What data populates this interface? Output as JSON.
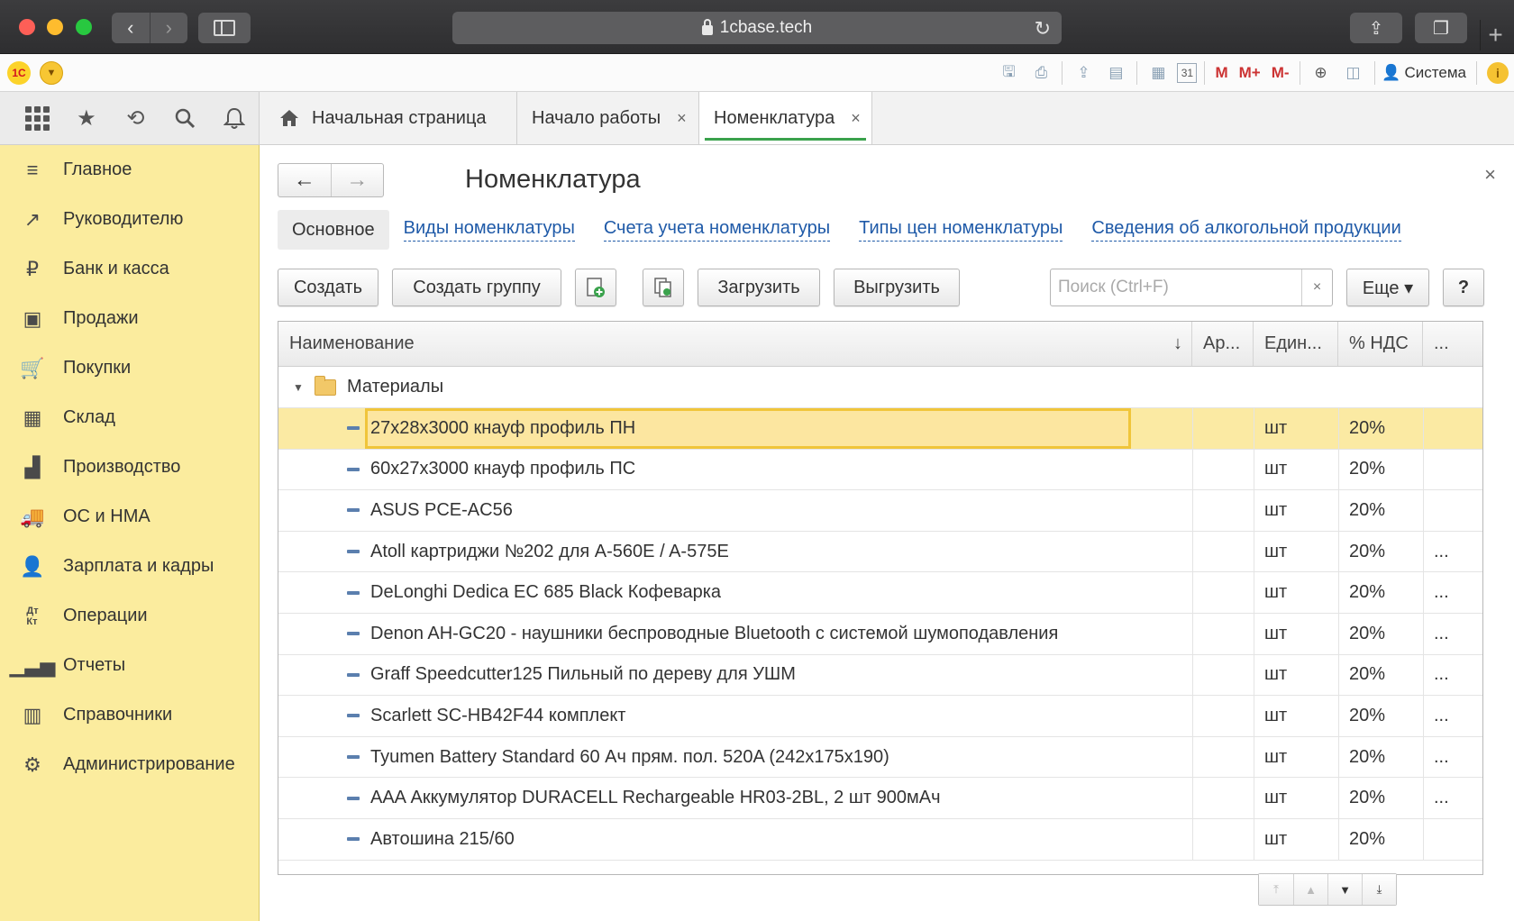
{
  "browser": {
    "url": "1cbase.tech",
    "back_icon": "chevron-left-icon",
    "forward_icon": "chevron-right-icon",
    "reload_icon": "reload-icon",
    "plus": "+"
  },
  "toolbar": {
    "logo": "1С",
    "m_label": "M",
    "m_plus_label": "M+",
    "m_minus_label": "M-",
    "user_label": "Система",
    "calendar_day": "31"
  },
  "tabs": {
    "home_label": "Начальная страница",
    "items": [
      {
        "label": "Начало работы",
        "close": "×"
      },
      {
        "label": "Номенклатура",
        "close": "×"
      }
    ]
  },
  "sidebar": {
    "items": [
      {
        "label": "Главное",
        "icon": "menu-lines-icon"
      },
      {
        "label": "Руководителю",
        "icon": "trend-icon"
      },
      {
        "label": "Банк и касса",
        "icon": "coin-icon"
      },
      {
        "label": "Продажи",
        "icon": "shopping-bag-icon"
      },
      {
        "label": "Покупки",
        "icon": "cart-icon"
      },
      {
        "label": "Склад",
        "icon": "warehouse-icon"
      },
      {
        "label": "Производство",
        "icon": "factory-icon"
      },
      {
        "label": "ОС и НМА",
        "icon": "truck-icon"
      },
      {
        "label": "Зарплата и кадры",
        "icon": "person-icon"
      },
      {
        "label": "Операции",
        "icon": "dt-kt-icon"
      },
      {
        "label": "Отчеты",
        "icon": "bar-chart-icon"
      },
      {
        "label": "Справочники",
        "icon": "books-icon"
      },
      {
        "label": "Администрирование",
        "icon": "gear-icon"
      }
    ]
  },
  "form": {
    "title": "Номенклатура",
    "close": "×",
    "nav_current": "Основное",
    "nav_links": [
      "Виды номенклатуры",
      "Счета учета номенклатуры",
      "Типы цен номенклатуры",
      "Сведения об алкогольной продукции"
    ],
    "buttons": {
      "create": "Создать",
      "create_group": "Создать группу",
      "load": "Загрузить",
      "unload": "Выгрузить",
      "more": "Еще ▾",
      "help": "?"
    },
    "search_placeholder": "Поиск (Ctrl+F)",
    "search_clear": "×"
  },
  "table": {
    "columns": [
      "Наименование",
      "Ар...",
      "Един...",
      "% НДС",
      "..."
    ],
    "sort_indicator": "↓",
    "group_row": "Материалы",
    "rows": [
      {
        "name": "27x28x3000 кнауф профиль ПН",
        "article": "",
        "unit": "шт",
        "vat": "20%",
        "more": ""
      },
      {
        "name": "60x27x3000 кнауф профиль ПС",
        "article": "",
        "unit": "шт",
        "vat": "20%",
        "more": ""
      },
      {
        "name": "ASUS PCE-AC56",
        "article": "",
        "unit": "шт",
        "vat": "20%",
        "more": ""
      },
      {
        "name": "Atoll картриджи №202 для A-560E / A-575E",
        "article": "",
        "unit": "шт",
        "vat": "20%",
        "more": "..."
      },
      {
        "name": "DeLonghi Dedica EC 685 Black Кофеварка",
        "article": "",
        "unit": "шт",
        "vat": "20%",
        "more": "..."
      },
      {
        "name": "Denon AH-GC20 - наушники беспроводные Bluetooth с системой шумоподавления",
        "article": "",
        "unit": "шт",
        "vat": "20%",
        "more": "..."
      },
      {
        "name": "Graff Speedcutter125 Пильный по дереву для УШМ",
        "article": "",
        "unit": "шт",
        "vat": "20%",
        "more": "..."
      },
      {
        "name": "Scarlett SC-HB42F44 комплект",
        "article": "",
        "unit": "шт",
        "vat": "20%",
        "more": "..."
      },
      {
        "name": "Tyumen Battery Standard 60 Ач прям. пол. 520A (242x175x190)",
        "article": "",
        "unit": "шт",
        "vat": "20%",
        "more": "..."
      },
      {
        "name": "AAA Аккумулятор DURACELL Rechargeable HR03-2BL, 2 шт 900мАч",
        "article": "",
        "unit": "шт",
        "vat": "20%",
        "more": "..."
      },
      {
        "name": "Автошина 215/60",
        "article": "",
        "unit": "шт",
        "vat": "20%",
        "more": ""
      }
    ],
    "selected_row": 0
  }
}
